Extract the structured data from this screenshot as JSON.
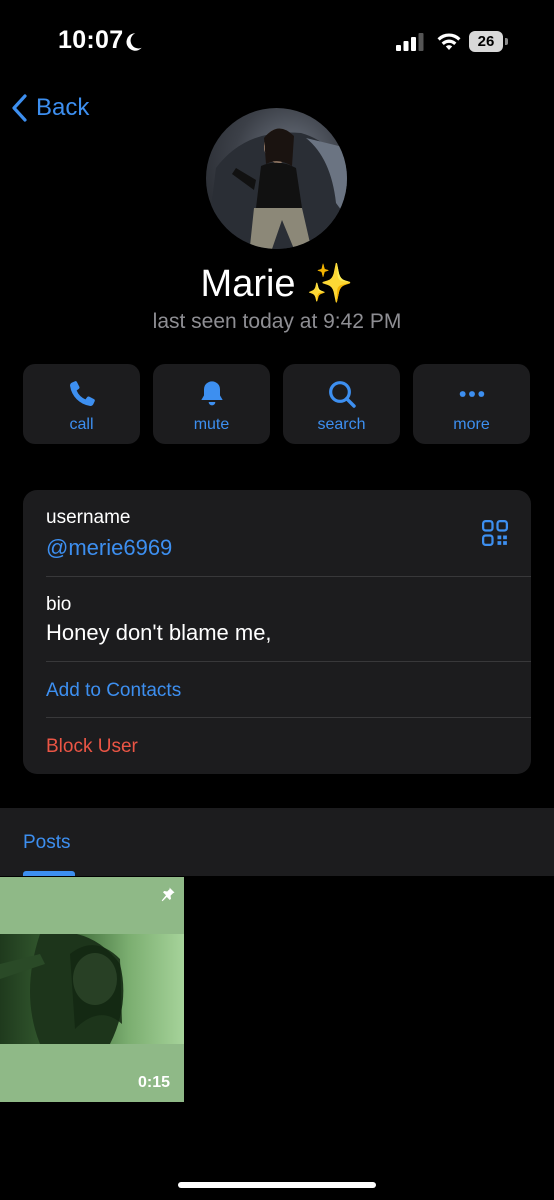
{
  "status_bar": {
    "time": "10:07",
    "battery": "26"
  },
  "nav": {
    "back_label": "Back"
  },
  "profile": {
    "name": "Marie ✨",
    "last_seen": "last seen today at 9:42 PM"
  },
  "actions": [
    {
      "label": "call",
      "icon": "phone-icon"
    },
    {
      "label": "mute",
      "icon": "bell-icon"
    },
    {
      "label": "search",
      "icon": "search-icon"
    },
    {
      "label": "more",
      "icon": "more-icon"
    }
  ],
  "info": {
    "username_caption": "username",
    "username": "@merie6969",
    "bio_caption": "bio",
    "bio": "Honey don't blame me,",
    "add_contact": "Add to Contacts",
    "block_user": "Block User"
  },
  "tabs": {
    "posts": "Posts"
  },
  "post": {
    "duration": "0:15",
    "pinned": true
  },
  "colors": {
    "accent": "#3d8ff0",
    "danger": "#eb5545",
    "card": "#1c1c1e",
    "background": "#000000"
  }
}
